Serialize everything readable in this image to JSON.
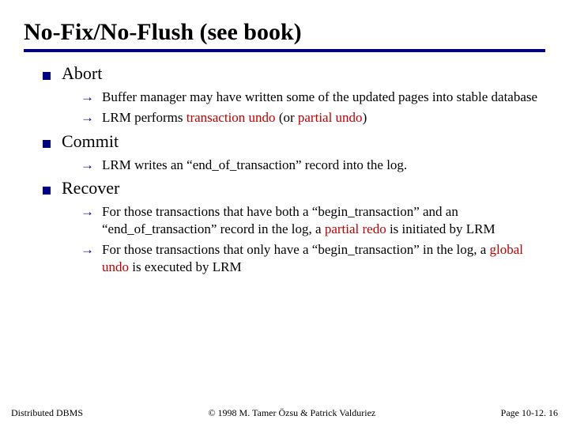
{
  "title": "No-Fix/No-Flush (see book)",
  "items": [
    {
      "label": "Abort",
      "subs": [
        {
          "parts": [
            {
              "t": "Buffer manager may have written some of the updated pages into stable database"
            }
          ]
        },
        {
          "parts": [
            {
              "t": "LRM  performs "
            },
            {
              "t": "transaction undo",
              "red": true
            },
            {
              "t": " (or "
            },
            {
              "t": "partial undo",
              "red": true
            },
            {
              "t": ")"
            }
          ]
        }
      ]
    },
    {
      "label": "Commit",
      "subs": [
        {
          "parts": [
            {
              "t": "LRM writes an “end_of_transaction” record into the log."
            }
          ]
        }
      ]
    },
    {
      "label": "Recover",
      "subs": [
        {
          "parts": [
            {
              "t": "For those transactions that have both a “begin_transaction” and an “end_of_transaction” record in the log, a "
            },
            {
              "t": "partial redo",
              "red": true
            },
            {
              "t": " is initiated by LRM"
            }
          ]
        },
        {
          "parts": [
            {
              "t": "For those transactions that only have a “begin_transaction” in the log, a "
            },
            {
              "t": "global undo",
              "red": true
            },
            {
              "t": " is executed by LRM"
            }
          ]
        }
      ]
    }
  ],
  "footer": {
    "left": "Distributed DBMS",
    "center": "© 1998 M. Tamer Özsu & Patrick Valduriez",
    "right": "Page 10-12. 16"
  }
}
